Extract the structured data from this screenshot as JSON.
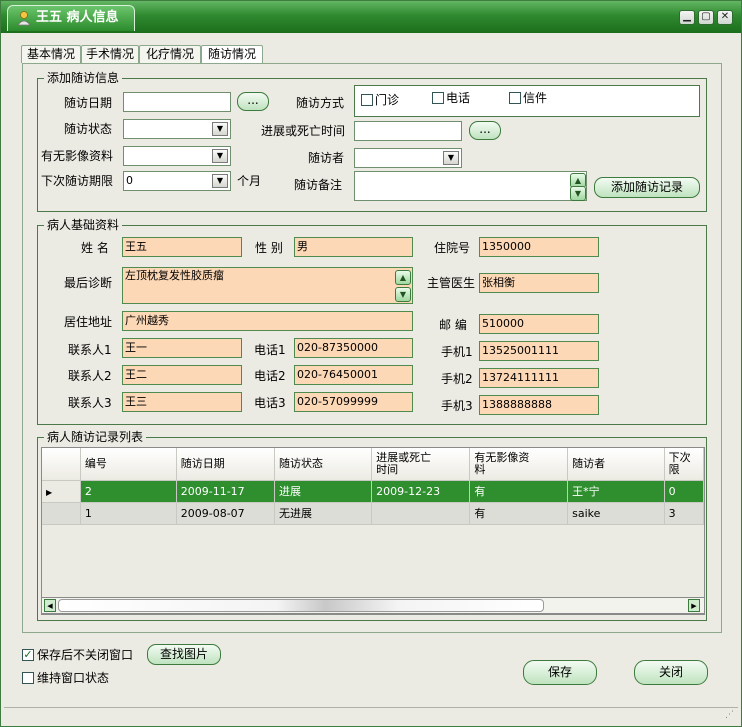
{
  "window": {
    "title": "王五 病人信息",
    "min": "▁",
    "max": "▢",
    "close": "✕"
  },
  "tabs": [
    {
      "label": "基本情况"
    },
    {
      "label": "手术情况"
    },
    {
      "label": "化疗情况"
    },
    {
      "label": "随访情况"
    }
  ],
  "add_followup": {
    "legend": "添加随访信息",
    "date_label": "随访日期",
    "date_value": "",
    "browse": "...",
    "method_label": "随访方式",
    "method_options": [
      "门诊",
      "电话",
      "信件"
    ],
    "status_label": "随访状态",
    "status_value": "",
    "progress_date_label": "进展或死亡时间",
    "progress_date_value": "",
    "imaging_label": "有无影像资料",
    "imaging_value": "",
    "followuper_label": "随访者",
    "followuper_value": "",
    "next_label": "下次随访期限",
    "next_value": "0",
    "next_unit": "个月",
    "remark_label": "随访备注",
    "remark_value": "",
    "add_button": "添加随访记录"
  },
  "basic": {
    "legend": "病人基础资料",
    "name_label": "姓 名",
    "name": "王五",
    "sex_label": "性 别",
    "sex": "男",
    "admission_label": "住院号",
    "admission": "1350000",
    "diag_label": "最后诊断",
    "diag": "左顶枕复发性胶质瘤",
    "doctor_label": "主管医生",
    "doctor": "张相衡",
    "address_label": "居住地址",
    "address": "广州越秀",
    "zip_label": "邮 编",
    "zip": "510000",
    "contacts": [
      {
        "label": "联系人1",
        "name": "王一",
        "phone_label": "电话1",
        "phone": "020-87350000",
        "mobile_label": "手机1",
        "mobile": "13525001111"
      },
      {
        "label": "联系人2",
        "name": "王二",
        "phone_label": "电话2",
        "phone": "020-76450001",
        "mobile_label": "手机2",
        "mobile": "13724111111"
      },
      {
        "label": "联系人3",
        "name": "王三",
        "phone_label": "电话3",
        "phone": "020-57099999",
        "mobile_label": "手机3",
        "mobile": "1388888888"
      }
    ]
  },
  "records": {
    "legend": "病人随访记录列表",
    "columns": [
      "编号",
      "随访日期",
      "随访状态",
      "进展或死亡时间",
      "有无影像资料",
      "随访者",
      "下次随访期限"
    ],
    "columns_display": [
      "编号",
      "随访日期",
      "随访状态",
      "进展或死亡\n时间",
      "有无影像资\n料",
      "随访者",
      "下次\n限"
    ],
    "rows": [
      [
        "2",
        "2009-11-17",
        "进展",
        "2009-12-23",
        "有",
        "王*宁",
        "0"
      ],
      [
        "1",
        "2009-08-07",
        "无进展",
        "",
        "有",
        "saike",
        "3"
      ]
    ]
  },
  "footer": {
    "keep_open_label": "保存后不关闭窗口",
    "keep_open": true,
    "find_image": "查找图片",
    "keep_state_label": "维持窗口状态",
    "keep_state": false,
    "save": "保存",
    "close": "关闭"
  },
  "colors": {
    "title_green": "#2f8a2f",
    "peach": "#fdd8b6",
    "selected_row": "#2f8f2f"
  }
}
